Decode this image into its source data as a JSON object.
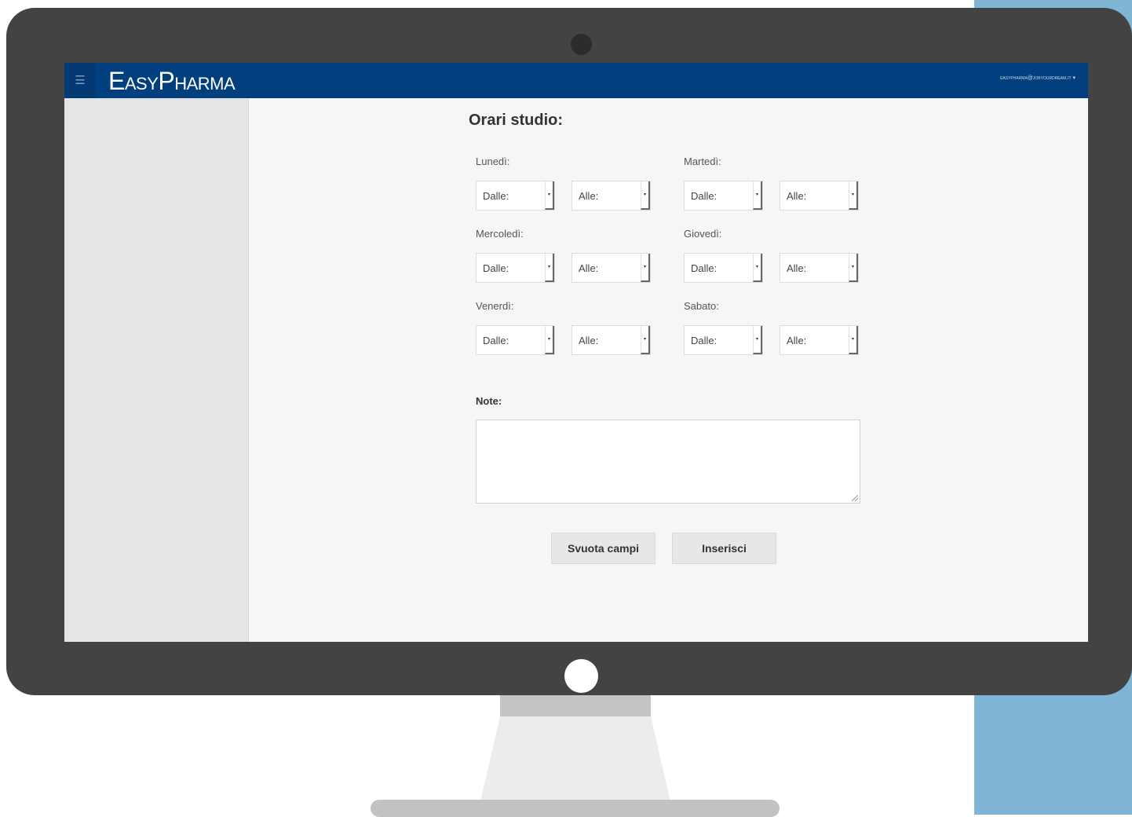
{
  "app": {
    "brand": "EasyPharma",
    "user_email": "easypharma@jobyourdream.it ▾",
    "menu_icon": "☰"
  },
  "form": {
    "title": "Orari studio:",
    "days": [
      {
        "label": "Lunedì:",
        "from": "Dalle:",
        "to": "Alle:"
      },
      {
        "label": "Martedì:",
        "from": "Dalle:",
        "to": "Alle:"
      },
      {
        "label": "Mercoledì:",
        "from": "Dalle:",
        "to": "Alle:"
      },
      {
        "label": "Giovedì:",
        "from": "Dalle:",
        "to": "Alle:"
      },
      {
        "label": "Venerdì:",
        "from": "Dalle:",
        "to": "Alle:"
      },
      {
        "label": "Sabato:",
        "from": "Dalle:",
        "to": "Alle:"
      }
    ],
    "notes_label": "Note:",
    "clear_button": "Svuota campi",
    "submit_button": "Inserisci"
  },
  "icons": {
    "dropdown_arrow": "▾"
  },
  "colors": {
    "navbar": "#023f7f",
    "accent_strip": "#80b5d6",
    "monitor": "#434343"
  }
}
